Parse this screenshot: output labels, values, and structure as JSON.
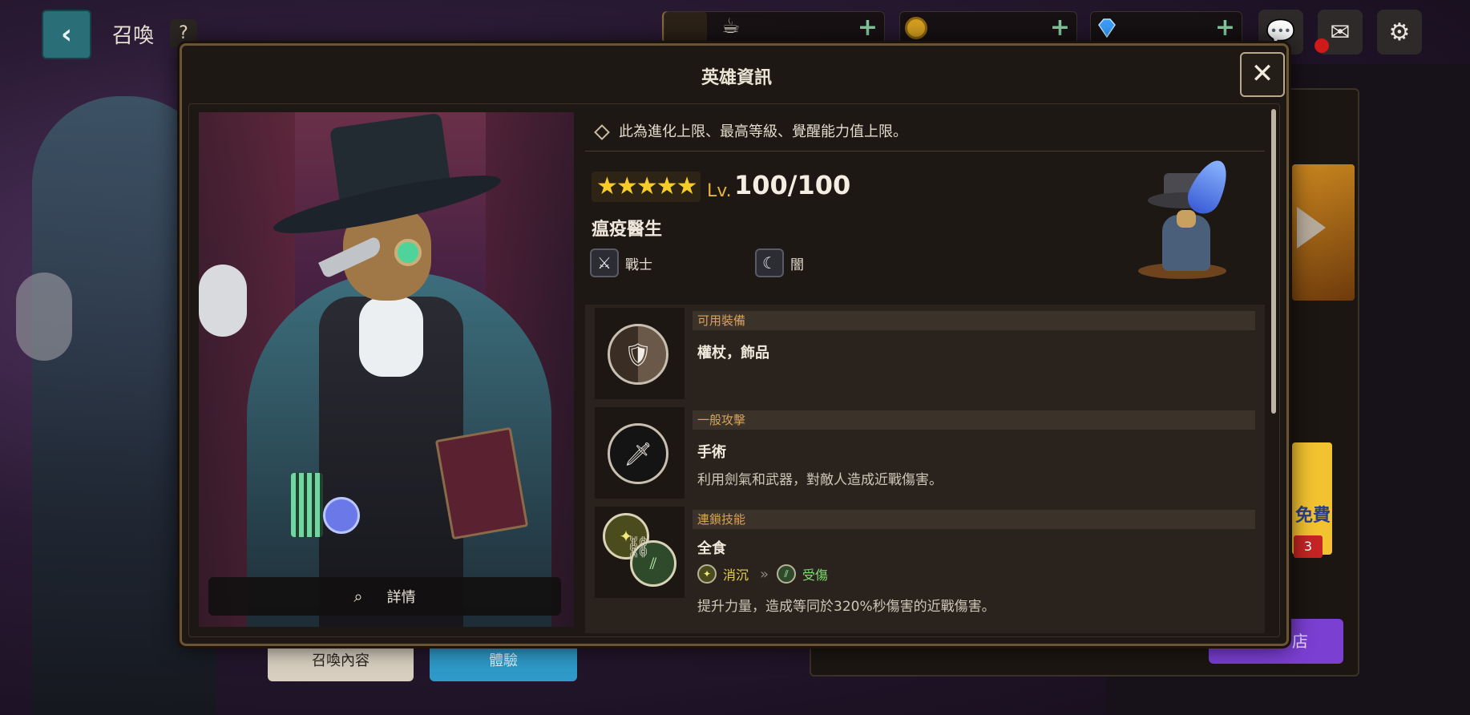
{
  "topbar": {
    "back_icon": "chevron-left-icon",
    "title": "召喚",
    "help_label": "?",
    "resources": [
      {
        "icon": "coffee-cup-icon",
        "value": ""
      },
      {
        "icon": "gold-coin-icon",
        "value": ""
      },
      {
        "icon": "diamond-gem-icon",
        "value": ""
      }
    ],
    "plus_label": "+",
    "chat_icon": "chat-bubble-icon",
    "mail_icon": "mail-icon",
    "settings_icon": "gear-icon"
  },
  "background": {
    "summon_content_label": "召喚內容",
    "trial_label": "體驗",
    "free_label": "免費",
    "badge_count": "3",
    "shop_label": "店"
  },
  "modal": {
    "title": "英雄資訊",
    "close_label": "✕",
    "detail_label": "詳情",
    "note": "此為進化上限、最高等級、覺醒能力值上限。",
    "stars": 5,
    "stars_text": "★★★★★",
    "lv_label": "Lv.",
    "lv_value": "100/100",
    "hero_name": "瘟疫醫生",
    "class_label": "戰士",
    "element_label": "闇",
    "skills": {
      "equipment": {
        "header": "可用裝備",
        "name": "權杖，飾品"
      },
      "normal_attack": {
        "header": "一般攻擊",
        "name": "手術",
        "desc": "利用劍氣和武器，對敵人造成近戰傷害。"
      },
      "chain_skill": {
        "header": "連鎖技能",
        "name": "全食",
        "from_state": "消沉",
        "to_state": "受傷",
        "desc": "提升力量，造成等同於320%秒傷害的近戰傷害。"
      }
    }
  },
  "colors": {
    "accent_gold": "#e7b33a",
    "star_yellow": "#f6cc2a",
    "header_orange": "#d9a35a",
    "state_down": "#e6d24a",
    "state_hurt": "#7edc72"
  }
}
